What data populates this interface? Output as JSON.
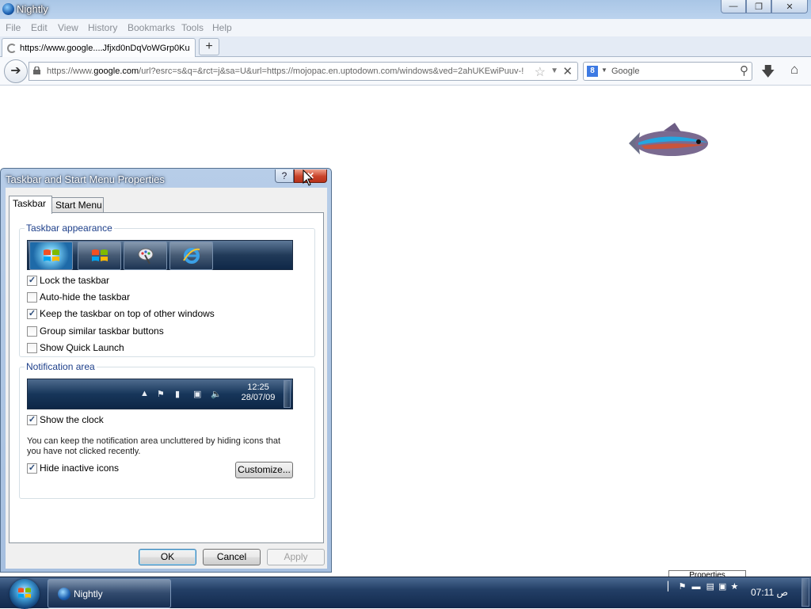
{
  "browser": {
    "window_title": "Nightly",
    "window_buttons": {
      "minimize": "—",
      "restore": "❐",
      "close": "✕"
    },
    "menu": [
      "File",
      "Edit",
      "View",
      "History",
      "Bookmarks",
      "Tools",
      "Help"
    ],
    "tab_title": "https://www.google....Jfjxd0nDqVoWGrp0Ku",
    "new_tab_label": "+",
    "url_prefix": "https://www.",
    "url_domain": "google.com",
    "url_rest": "/url?esrc=s&q=&rct=j&sa=U&url=https://mojopac.en.uptodown.com/windows&ved=2ahUKEwiPuuv-!",
    "search_placeholder": "Google",
    "search_engine_letter": "8"
  },
  "dialog": {
    "title": "Taskbar and Start Menu Properties",
    "help_label": "?",
    "close_label": "✕",
    "tabs": [
      "Taskbar",
      "Start Menu"
    ],
    "taskbar_appearance": {
      "legend": "Taskbar appearance",
      "options": [
        {
          "label": "Lock the taskbar",
          "checked": true
        },
        {
          "label": "Auto-hide the taskbar",
          "checked": false
        },
        {
          "label": "Keep the taskbar on top of other windows",
          "checked": true
        },
        {
          "label": "Group similar taskbar buttons",
          "checked": false
        },
        {
          "label": "Show Quick Launch",
          "checked": false
        }
      ]
    },
    "notification_area": {
      "legend": "Notification area",
      "clock_time": "12:25",
      "clock_date": "28/07/09",
      "show_clock": {
        "label": "Show the clock",
        "checked": true
      },
      "info_text": "You can keep the notification area uncluttered by hiding icons that you have not clicked recently.",
      "hide_inactive": {
        "label": "Hide inactive icons",
        "checked": true
      },
      "customize_label": "Customize..."
    },
    "buttons": {
      "ok": "OK",
      "cancel": "Cancel",
      "apply": "Apply"
    }
  },
  "taskbar": {
    "task_label": "Nightly",
    "tooltip_text": "Properties",
    "clock": "07:11 ص"
  },
  "colors": {
    "titlebar": "#bcd3ee",
    "taskbar": "#1a335a",
    "close_button": "#c9432a",
    "legend_text": "#1d3f8a"
  }
}
